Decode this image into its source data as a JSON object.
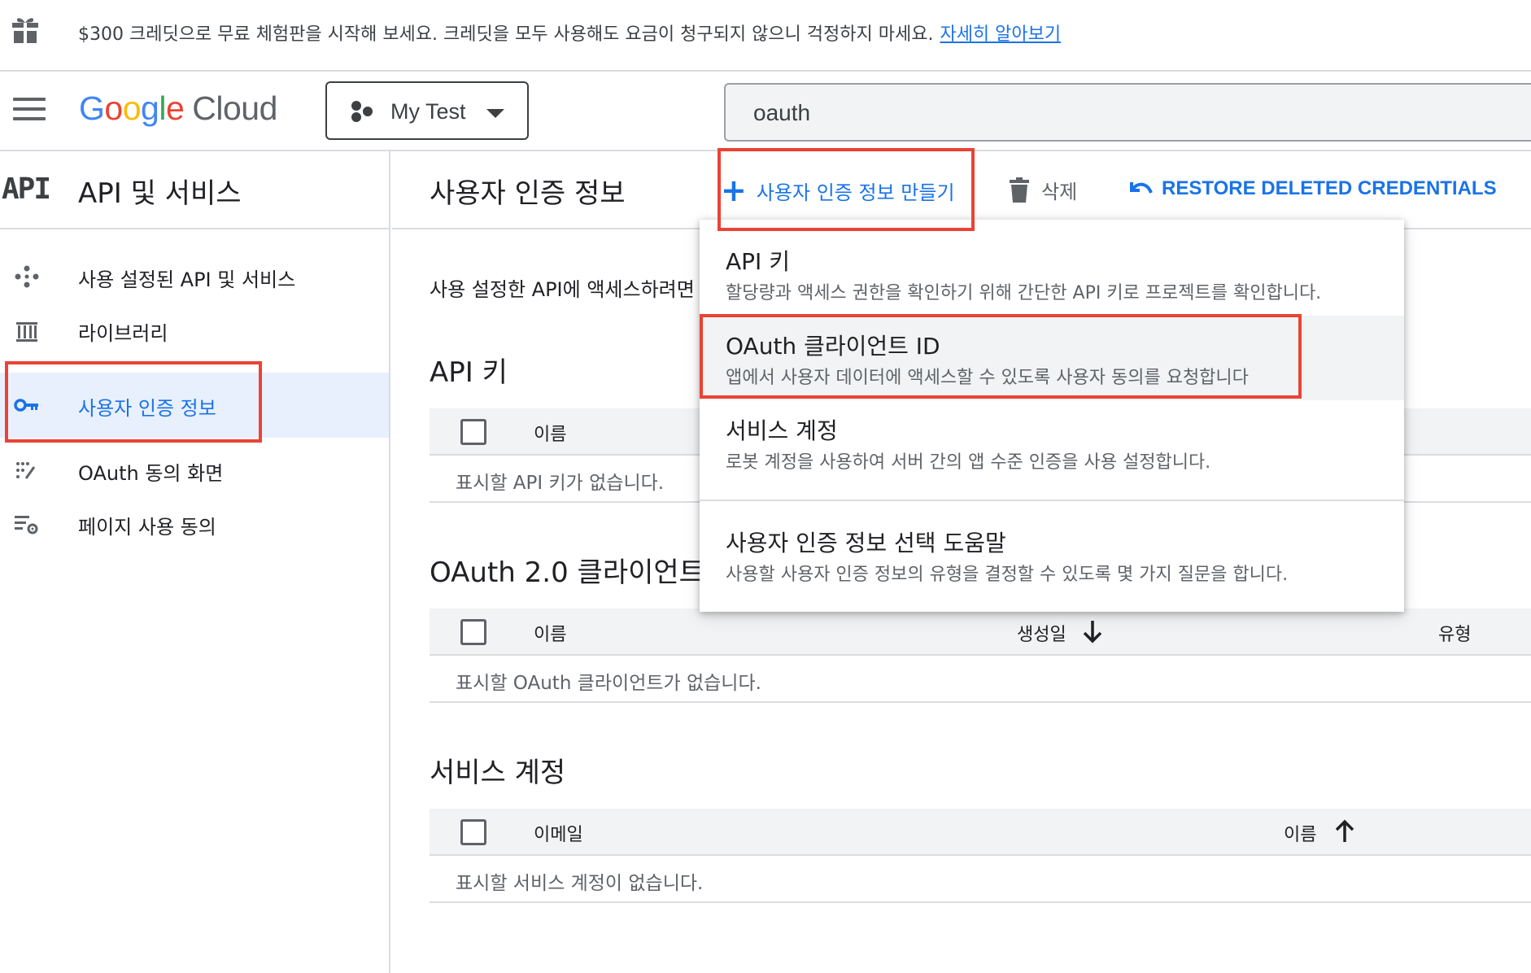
{
  "promo": {
    "text": "$300 크레딧으로 무료 체험판을 시작해 보세요. 크레딧을 모두 사용해도 요금이 청구되지 않으니 걱정하지 마세요.",
    "link": "자세히 알아보기",
    "icon": "gift-icon"
  },
  "header": {
    "logo_google": [
      "G",
      "o",
      "o",
      "g",
      "l",
      "e"
    ],
    "logo_colors": [
      "#4285f4",
      "#ea4335",
      "#fbbc04",
      "#4285f4",
      "#34a853",
      "#ea4335"
    ],
    "logo_cloud": "Cloud",
    "project": "My Test",
    "search_value": "oauth"
  },
  "sidebar": {
    "logo": "API",
    "title": "API 및 서비스",
    "items": [
      {
        "label": "사용 설정된 API 및 서비스",
        "icon": "diamond-dots-icon",
        "active": false
      },
      {
        "label": "라이브러리",
        "icon": "library-icon",
        "active": false
      },
      {
        "label": "사용자 인증 정보",
        "icon": "key-icon",
        "active": true
      },
      {
        "label": "OAuth 동의 화면",
        "icon": "consent-dots-icon",
        "active": false
      },
      {
        "label": "페이지 사용 동의",
        "icon": "settings-list-icon",
        "active": false
      }
    ]
  },
  "toolbar": {
    "title": "사용자 인증 정보",
    "create_label": "사용자 인증 정보 만들기",
    "delete_label": "삭제",
    "restore_label": "RESTORE DELETED CREDENTIALS"
  },
  "main": {
    "intro": "사용 설정한 API에 액세스하려면",
    "api_keys": {
      "title": "API 키",
      "col_name": "이름",
      "empty": "표시할 API 키가 없습니다."
    },
    "oauth": {
      "title": "OAuth 2.0 클라이언트",
      "col_name": "이름",
      "col_created": "생성일",
      "col_type": "유형",
      "empty": "표시할 OAuth 클라이언트가 없습니다."
    },
    "service_accounts": {
      "title": "서비스 계정",
      "col_email": "이메일",
      "col_name": "이름",
      "empty": "표시할 서비스 계정이 없습니다."
    }
  },
  "menu": {
    "items": [
      {
        "title": "API 키",
        "desc": "할당량과 액세스 권한을 확인하기 위해 간단한 API 키로 프로젝트를 확인합니다."
      },
      {
        "title": "OAuth 클라이언트 ID",
        "desc": "앱에서 사용자 데이터에 액세스할 수 있도록 사용자 동의를 요청합니다"
      },
      {
        "title": "서비스 계정",
        "desc": "로봇 계정을 사용하여 서버 간의 앱 수준 인증을 사용 설정합니다."
      },
      {
        "title": "사용자 인증 정보 선택 도움말",
        "desc": "사용할 사용자 인증 정보의 유형을 결정할 수 있도록 몇 가지 질문을 합니다."
      }
    ]
  },
  "colors": {
    "accent": "#1a73e8",
    "annotation": "#ea4335",
    "active_bg": "#e8f0fe"
  }
}
